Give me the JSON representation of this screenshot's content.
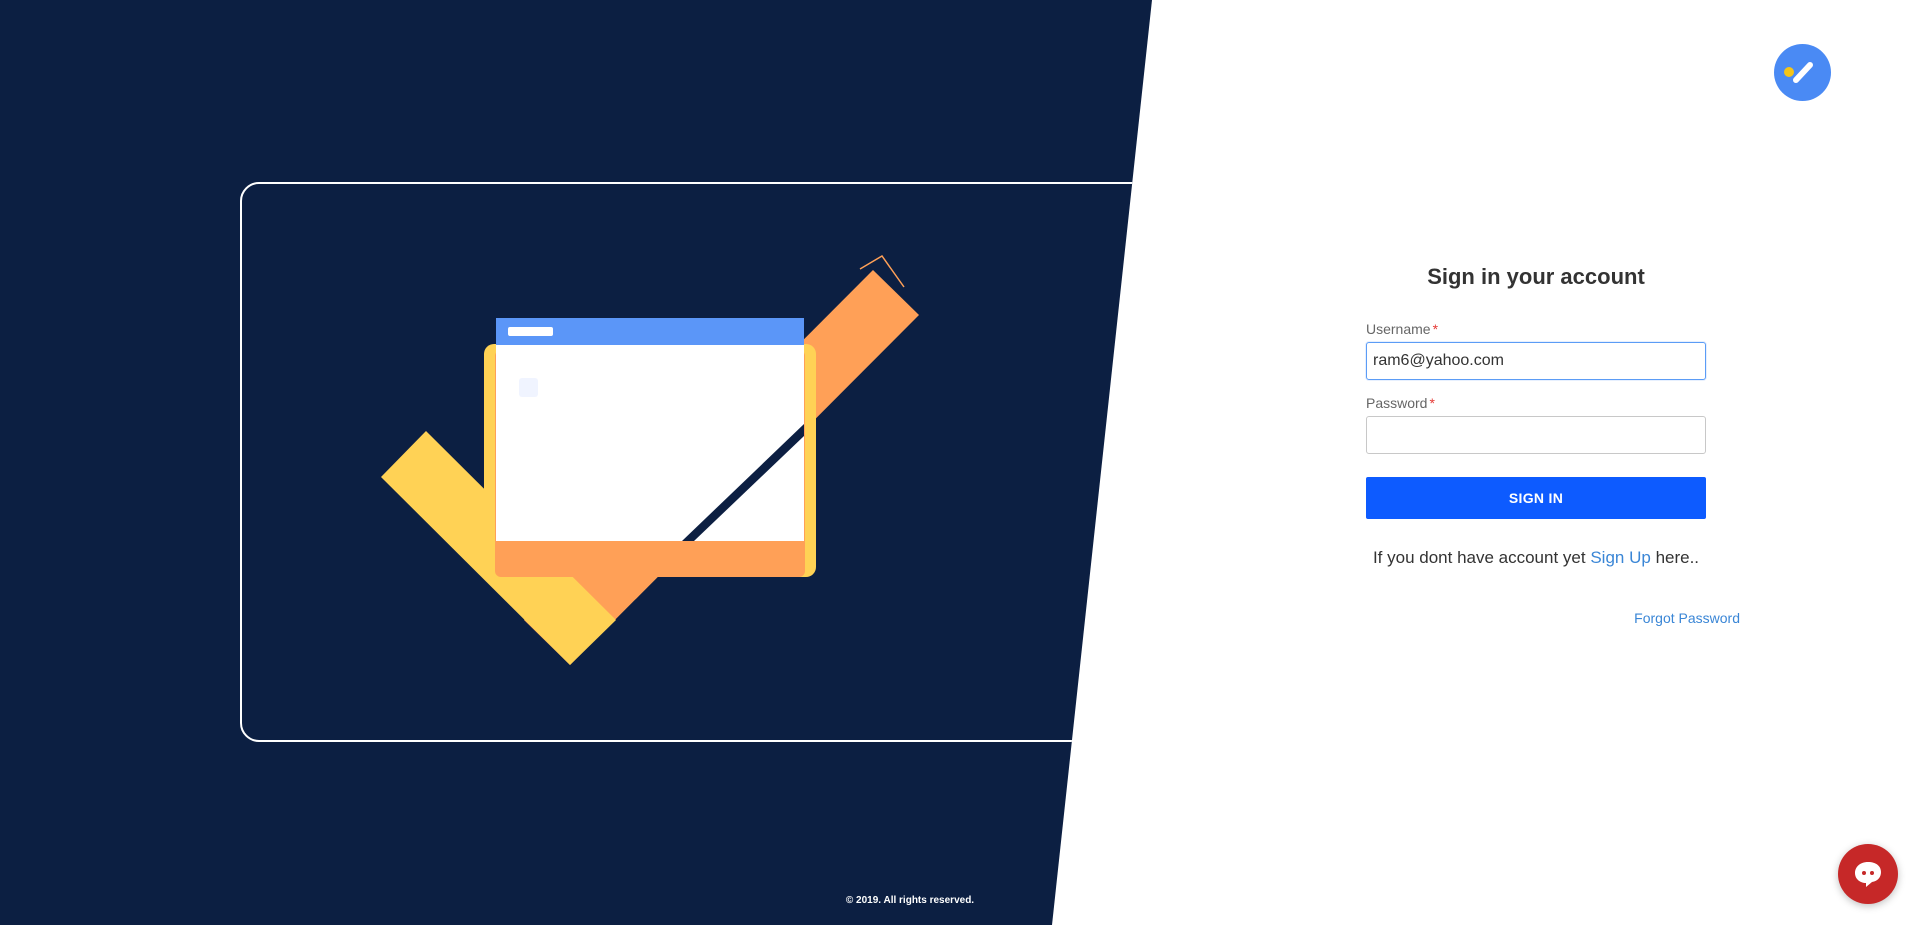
{
  "colors": {
    "left_panel_bg": "#0c1f42",
    "accent_blue": "#0d5bff",
    "link_blue": "#3a86d6",
    "check_yellow": "#ffd255",
    "check_orange": "#ffa057",
    "window_header_blue": "#5b96f8",
    "chat_red": "#c62828",
    "logo_blue": "#4a8af4",
    "logo_yellow": "#f5c518"
  },
  "left_panel": {
    "copyright": "© 2019. All rights reserved."
  },
  "brand": {
    "logo_icon": "brand-logo-icon"
  },
  "form": {
    "title": "Sign in your account",
    "username": {
      "label": "Username",
      "required_mark": "*",
      "value": "ram6@yahoo.com"
    },
    "password": {
      "label": "Password",
      "required_mark": "*",
      "value": ""
    },
    "submit_label": "SIGN IN",
    "signup_prefix": "If you dont have account yet",
    "signup_link": "Sign Up",
    "signup_suffix": "here..",
    "forgot_link": "Forgot Password"
  },
  "chat": {
    "icon": "chat-bubble-icon"
  }
}
